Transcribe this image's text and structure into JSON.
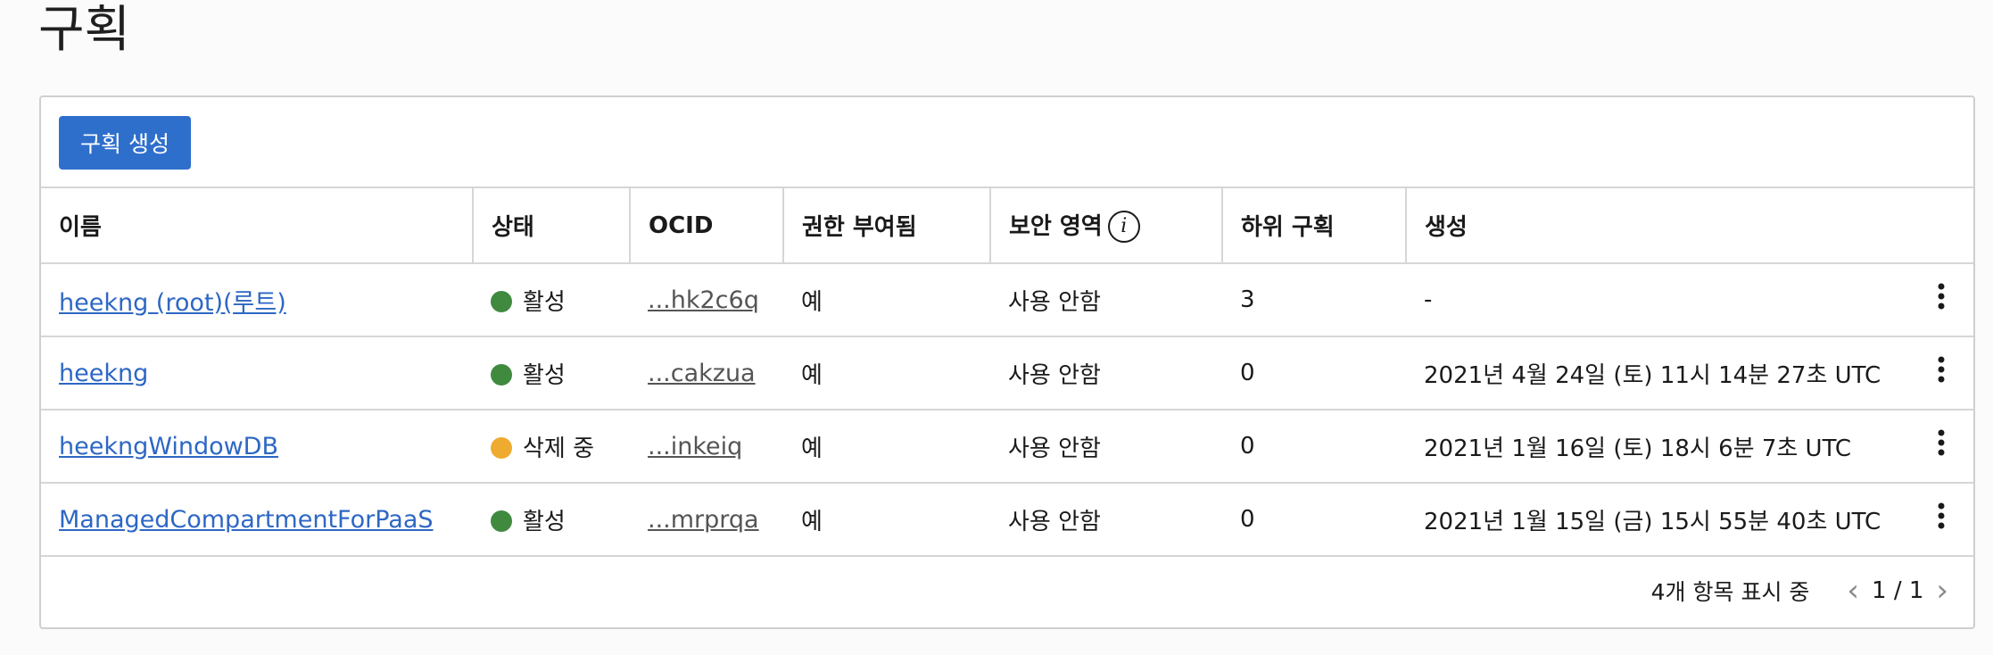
{
  "page": {
    "title": "구획"
  },
  "toolbar": {
    "create_label": "구획 생성"
  },
  "table": {
    "headers": [
      "이름",
      "상태",
      "OCID",
      "권한 부여됨",
      "보안 영역",
      "하위 구획",
      "생성"
    ],
    "rows": [
      {
        "name": "heekng (root)(루트)",
        "state": "활성",
        "state_color": "#3f8a3f",
        "ocid": "...hk2c6q",
        "authorized": "예",
        "security_zone": "사용 안함",
        "sub": "3",
        "created": "-"
      },
      {
        "name": "heekng",
        "state": "활성",
        "state_color": "#3f8a3f",
        "ocid": "...cakzua",
        "authorized": "예",
        "security_zone": "사용 안함",
        "sub": "0",
        "created": "2021년 4월 24일 (토) 11시 14분 27초 UTC"
      },
      {
        "name": "heekngWindowDB",
        "state": "삭제 중",
        "state_color": "#efab2f",
        "ocid": "...inkeiq",
        "authorized": "예",
        "security_zone": "사용 안함",
        "sub": "0",
        "created": "2021년 1월 16일 (토) 18시 6분 7초 UTC"
      },
      {
        "name": "ManagedCompartmentForPaaS",
        "state": "활성",
        "state_color": "#3f8a3f",
        "ocid": "...mrprqa",
        "authorized": "예",
        "security_zone": "사용 안함",
        "sub": "0",
        "created": "2021년 1월 15일 (금) 15시 55분 40초 UTC"
      }
    ]
  },
  "footer": {
    "count_text": "4개 항목 표시 중",
    "page_text": "1 / 1"
  },
  "icons": {
    "info": "info-icon",
    "kebab": "more-vertical-icon",
    "prev": "chevron-left-icon",
    "next": "chevron-right-icon"
  }
}
